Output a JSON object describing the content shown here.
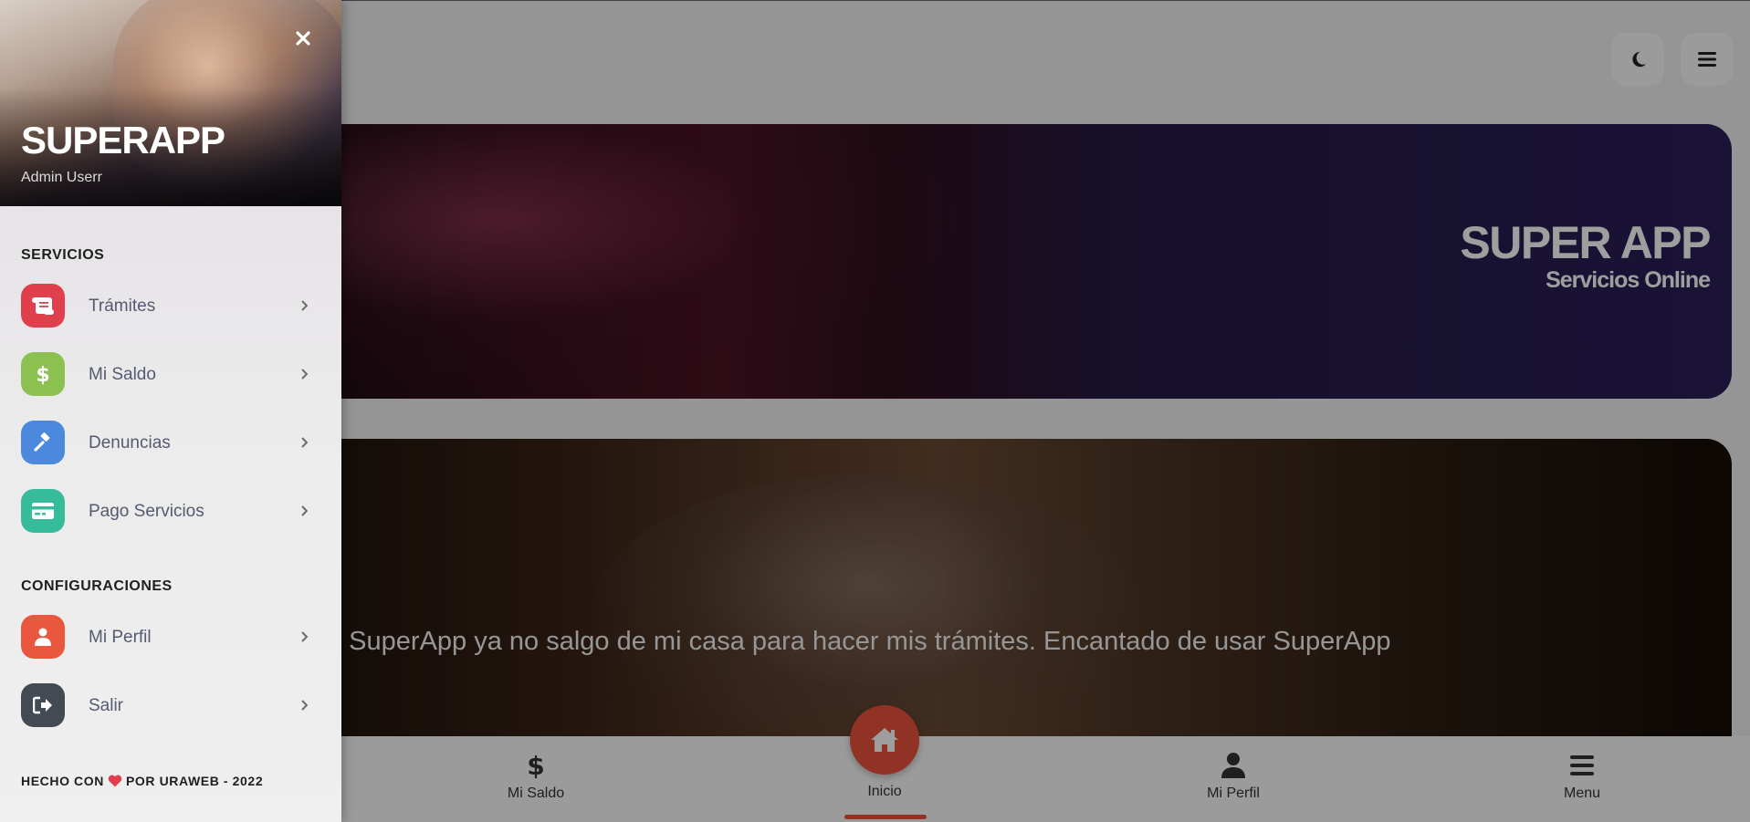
{
  "header_buttons": {
    "theme_icon": "moon-icon",
    "menu_icon": "hamburger-icon"
  },
  "hero": {
    "title": "SUPER APP",
    "subtitle": "Servicios Online"
  },
  "testimonial": {
    "quote": "n SuperApp ya no salgo de mi casa para hacer mis trámites. Encantado de usar SuperApp"
  },
  "bottom_nav": {
    "items": [
      {
        "label": "Mi Saldo",
        "icon": "dollar-icon"
      },
      {
        "label": "Inicio",
        "icon": "home-icon"
      },
      {
        "label": "Mi Perfil",
        "icon": "user-icon"
      },
      {
        "label": "Menu",
        "icon": "hamburger-icon"
      }
    ],
    "accent_color": "#e9533c"
  },
  "sidebar": {
    "title": "SUPERAPP",
    "user": "Admin Userr",
    "sections": [
      {
        "title": "SERVICIOS",
        "items": [
          {
            "label": "Trámites",
            "icon": "scroll-icon",
            "color": "#e0404e"
          },
          {
            "label": "Mi Saldo",
            "icon": "dollar-icon",
            "color": "#8cc152"
          },
          {
            "label": "Denuncias",
            "icon": "gavel-icon",
            "color": "#4a89dc"
          },
          {
            "label": "Pago Servicios",
            "icon": "credit-card-icon",
            "color": "#37bc9b"
          }
        ]
      },
      {
        "title": "CONFIGURACIONES",
        "items": [
          {
            "label": "Mi Perfil",
            "icon": "user-icon",
            "color": "#e9573f"
          },
          {
            "label": "Salir",
            "icon": "sign-out-icon",
            "color": "#434a54"
          }
        ]
      }
    ],
    "footer": {
      "before": "HECHO CON",
      "after": "POR URAWEB - 2022",
      "heart_color": "#e0404e"
    }
  }
}
